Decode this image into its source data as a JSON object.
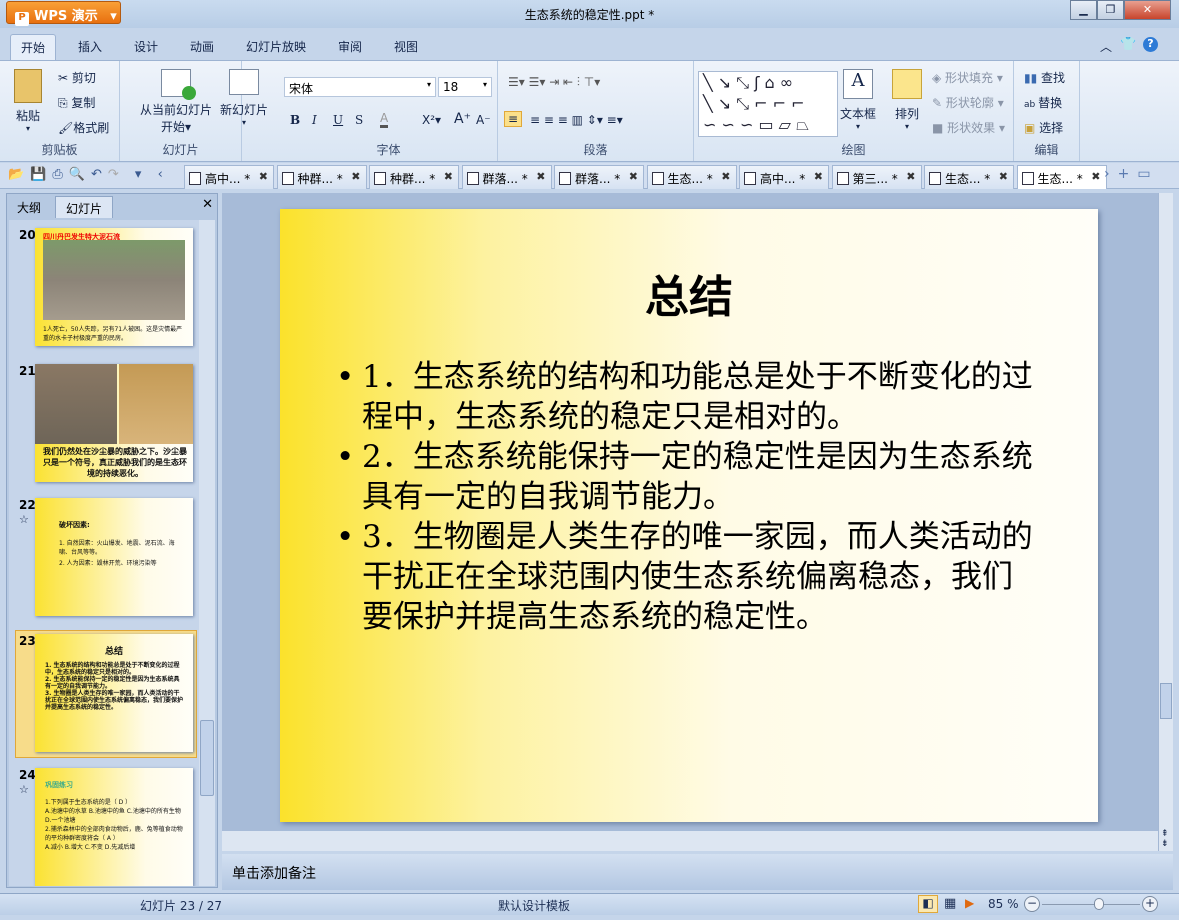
{
  "app": {
    "name": "WPS 演示",
    "title": "生态系统的稳定性.ppt *"
  },
  "menu_tabs": [
    "开始",
    "插入",
    "设计",
    "动画",
    "幻灯片放映",
    "审阅",
    "视图"
  ],
  "ribbon": {
    "clipboard": {
      "label": "剪贴板",
      "paste": "粘贴",
      "cut": "剪切",
      "copy": "复制",
      "format_painter": "格式刷"
    },
    "slides": {
      "label": "幻灯片",
      "from_current": "从当前幻灯片",
      "from_current2": "开始",
      "new_slide": "新幻灯片"
    },
    "font": {
      "label": "字体",
      "font_name": "宋体",
      "font_size": "18",
      "bold": "B",
      "italic": "I",
      "underline": "U",
      "shadow": "S"
    },
    "paragraph": {
      "label": "段落"
    },
    "drawing": {
      "label": "绘图",
      "textbox": "文本框",
      "arrange": "排列",
      "shape_fill": "形状填充",
      "shape_outline": "形状轮廓",
      "shape_effect": "形状效果"
    },
    "editing": {
      "label": "编辑",
      "find": "查找",
      "replace": "替换",
      "select": "选择"
    }
  },
  "doc_tabs": [
    "高中...",
    "种群...",
    "种群...",
    "群落...",
    "群落...",
    "生态...",
    "高中...",
    "第三...",
    "生态...",
    "生态..."
  ],
  "doc_tab_modified": "*",
  "panel": {
    "tabs": [
      "大纲",
      "幻灯片"
    ],
    "active": "幻灯片"
  },
  "thumbnails": [
    {
      "num": "20",
      "title": "四川丹巴发生特大泥石流",
      "caption": "1人死亡，50人失踪，另有71人被困。这是灾情最严重的水卡子村极度严重的民房。"
    },
    {
      "num": "21",
      "caption": "我们仍然处在沙尘暴的威胁之下。沙尘暴只是一个符号，真正威胁我们的是生态环境的持续恶化。"
    },
    {
      "num": "22",
      "title": "破坏因素:",
      "lines": [
        "1. 自然因素：火山爆发、地震、泥石流、海啸、台风等等。",
        "2. 人为因素：毁林开荒、环境污染等"
      ]
    },
    {
      "num": "23",
      "title": "总结",
      "lines": [
        "1. 生态系统的结构和功能总是处于不断变化的过程中，生态系统的稳定只是相对的。",
        "2. 生态系统能保持一定的稳定性是因为生态系统具有一定的自我调节能力。",
        "3. 生物圈是人类生存的唯一家园，而人类活动的干扰正在全球范围内使生态系统偏离稳态，我们要保护并提高生态系统的稳定性。"
      ]
    },
    {
      "num": "24",
      "title": "巩固练习",
      "lines": [
        "1.下列属于生态系统的是（ D ）",
        "A.池塘中的水草  B.池塘中的鱼  C.池塘中的所有生物  D.一个池塘",
        "2.捕杀森林中的全部肉食动物后，鹿、兔等植食动物的平均种群密度将会（ A ）",
        "A.减小    B.增大    C.不变    D.先减后增"
      ]
    }
  ],
  "slide": {
    "title": "总结",
    "bullets": [
      "1．生态系统的结构和功能总是处于不断变化的过程中，生态系统的稳定只是相对的。",
      "2．生态系统能保持一定的稳定性是因为生态系统具有一定的自我调节能力。",
      "3．生物圈是人类生存的唯一家园，而人类活动的干扰正在全球范围内使生态系统偏离稳态，我们要保护并提高生态系统的稳定性。"
    ]
  },
  "notes_placeholder": "单击添加备注",
  "status": {
    "slide_count": "幻灯片 23 / 27",
    "template": "默认设计模板",
    "zoom": "85 %",
    "zoom_percent": 85
  }
}
